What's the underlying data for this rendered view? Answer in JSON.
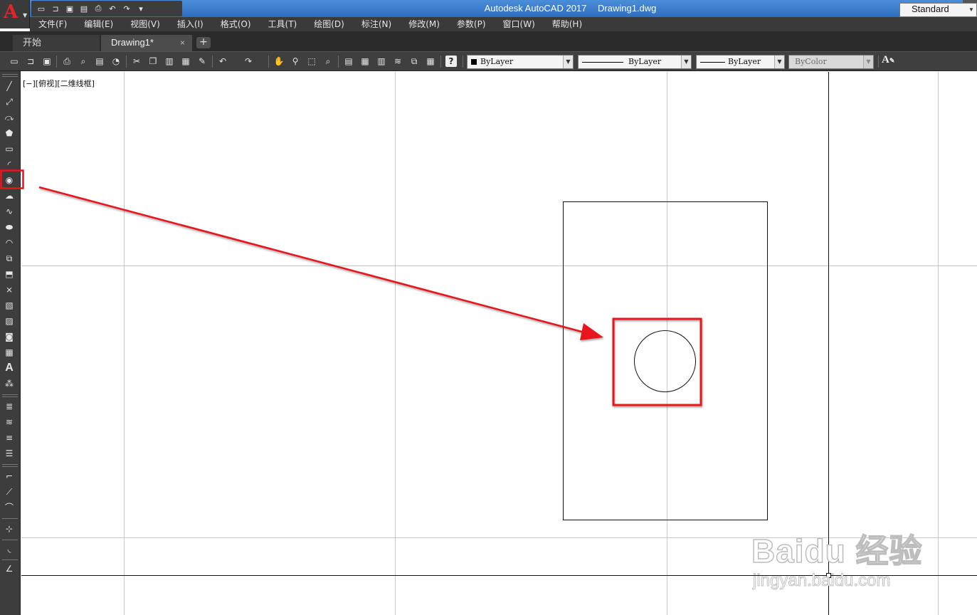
{
  "titlebar": {
    "app_name": "Autodesk AutoCAD 2017",
    "file_name": "Drawing1.dwg",
    "logo_letter": "A"
  },
  "quick_access": [
    "new-icon",
    "open-icon",
    "save-icon",
    "saveas-icon",
    "plot-icon",
    "undo-icon",
    "redo-icon",
    "customize-icon"
  ],
  "menu": [
    "文件(F)",
    "编辑(E)",
    "视图(V)",
    "插入(I)",
    "格式(O)",
    "工具(T)",
    "绘图(D)",
    "标注(N)",
    "修改(M)",
    "参数(P)",
    "窗口(W)",
    "帮助(H)"
  ],
  "tabs": [
    {
      "label": "开始",
      "active": false
    },
    {
      "label": "Drawing1*",
      "active": true
    }
  ],
  "tab_close": "×",
  "tab_add": "+",
  "properties": {
    "color": "ByLayer",
    "linetype": "ByLayer",
    "lineweight": "ByLayer",
    "plotstyle": "ByColor",
    "text_style": "Standard"
  },
  "viewport_label": "[−][俯视][二维线框]",
  "left_tools": [
    "line",
    "construction-line",
    "polyline",
    "polygon",
    "rectangle",
    "arc",
    "circle",
    "revision-cloud",
    "spline",
    "ellipse",
    "ellipse-arc",
    "insert-block",
    "make-block",
    "point",
    "hatch",
    "gradient",
    "region",
    "table",
    "multiline-text",
    "add-selected"
  ],
  "highlighted_tool": "circle",
  "watermark": {
    "brand": "Baidu 经验",
    "url": "jingyan.baidu.com"
  },
  "colors": {
    "accent_red": "#e8141c",
    "titlebar_blue": "#3a7bd0",
    "dark_ui": "#3d3d3d"
  }
}
